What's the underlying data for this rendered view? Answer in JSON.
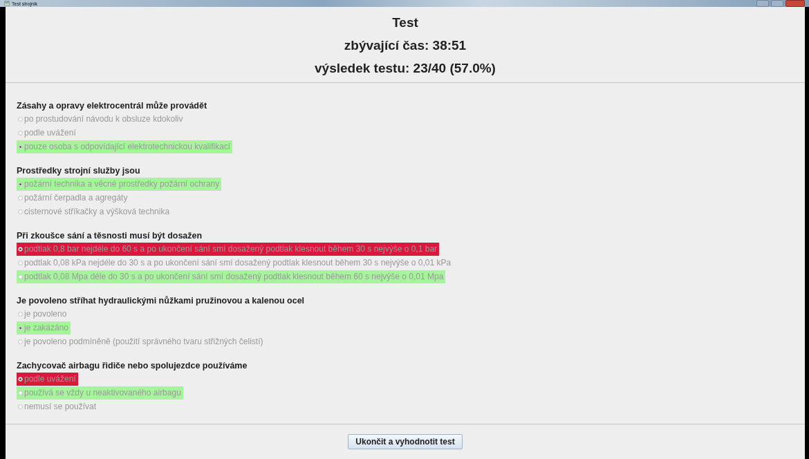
{
  "window": {
    "title": "Test strojnik"
  },
  "header": {
    "title": "Test",
    "time_left": "zbývající čas: 38:51",
    "result": "výsledek testu: 23/40 (57.0%)"
  },
  "questions": [
    {
      "text": "Zásahy a opravy elektrocentrál může provádět",
      "options": [
        {
          "label": "po prostudování návodu k obsluze kdokoliv",
          "selected": false
        },
        {
          "label": "podle uvážení",
          "selected": false
        },
        {
          "label": "pouze osoba s odpovídající elektrotechnickou kvalifikací",
          "selected": true,
          "color": "#a6f59c"
        }
      ]
    },
    {
      "text": "Prostředky strojní služby jsou",
      "options": [
        {
          "label": "požární technika a věcné prostředky požární ochrany",
          "selected": true,
          "color": "#a6f59c"
        },
        {
          "label": "požární čerpadla a agregáty",
          "selected": false
        },
        {
          "label": "cisternové stříkačky a výšková technika",
          "selected": false
        }
      ]
    },
    {
      "text": "Při zkoušce sání a těsnosti musí být dosažen",
      "options": [
        {
          "label": "podtlak 0,8 bar nejdéle do 60 s a po ukončení sání smí dosažený podtlak klesnout během 30 s nejvýše o 0,1 bar",
          "selected": true,
          "color": "#d8193d"
        },
        {
          "label": "podtlak 0,08 kPa nejdéle do 30 s a po ukončení sání smí dosažený podtlak klesnout během 30 s nejvýše o 0,01 kPa",
          "selected": false
        },
        {
          "label": "podtlak 0,08 Mpa déle do 30 s a po ukončení sání smí dosažený podtlak klesnout během 60 s nejvýše o 0,01 Mpa",
          "selected": false,
          "color": "#a6f59c"
        }
      ]
    },
    {
      "text": "Je povoleno stříhat hydraulickými nůžkami pružinovou a kalenou ocel",
      "options": [
        {
          "label": "je povoleno",
          "selected": false
        },
        {
          "label": "je zakázáno",
          "selected": true,
          "color": "#a6f59c"
        },
        {
          "label": "je povoleno podmíněně (použití správného tvaru střižných čelistí)",
          "selected": false
        }
      ]
    },
    {
      "text": "Zachycovač airbagu řidiče nebo spolujezdce používáme",
      "options": [
        {
          "label": "podle uvážení",
          "selected": true,
          "color": "#d8193d"
        },
        {
          "label": "používá se vždy u neaktivovaného airbagu",
          "selected": false,
          "color": "#a6f59c"
        },
        {
          "label": "nemusí se používat",
          "selected": false
        }
      ]
    }
  ],
  "submit_button": "Ukončit a vyhodnotit test"
}
